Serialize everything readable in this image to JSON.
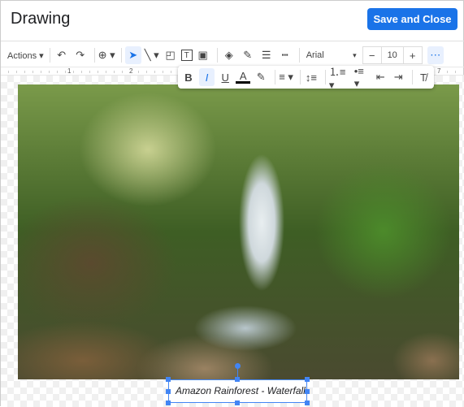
{
  "header": {
    "title": "Drawing",
    "save_label": "Save and Close"
  },
  "toolbar": {
    "actions": "Actions ▾",
    "undo": "↶",
    "redo": "↷",
    "zoom": "⊕ ▾",
    "select": "➤",
    "line": "╲ ▾",
    "shape": "◰",
    "textbox": "T",
    "image": "▣",
    "fill": "◈",
    "pen": "✎",
    "border_weight": "☰",
    "border_dash": "┅",
    "font": "Arial",
    "font_caret": "▾",
    "size_minus": "−",
    "font_size": "10",
    "size_plus": "+",
    "more": "⋯"
  },
  "ruler": {
    "marks": [
      "1",
      "2",
      "7"
    ]
  },
  "text_toolbar": {
    "bold": "B",
    "italic": "I",
    "underline": "U",
    "text_color": "A",
    "highlight": "✎",
    "align": "≡ ▾",
    "line_spacing": "↕≡",
    "numbered_list": "⒈≡ ▾",
    "bulleted_list": "•≡ ▾",
    "decrease_indent": "⇤",
    "increase_indent": "⇥",
    "clear_formatting": "T̸"
  },
  "caption": {
    "text": "Amazon Rainforest - Waterfall"
  },
  "colors": {
    "accent": "#1a73e8",
    "selection": "#4285f4"
  }
}
